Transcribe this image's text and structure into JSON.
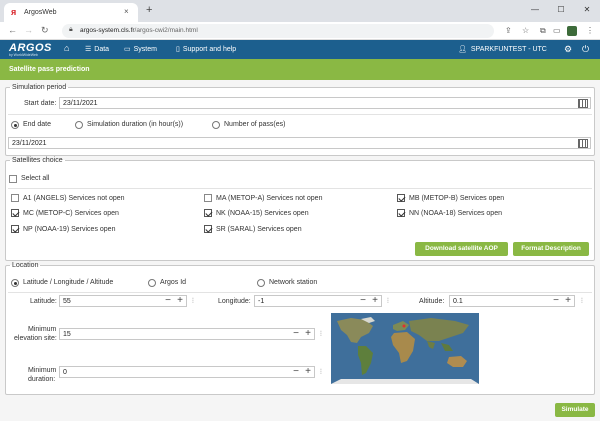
{
  "browser": {
    "tab_title": "ArgosWeb",
    "url_host": "argos-system.cls.fr",
    "url_path": "/argos-cwi2/main.html",
    "tab_close": "×",
    "new_tab": "+",
    "win_min": "—",
    "win_max": "☐",
    "win_close": "✕"
  },
  "nav": {
    "logo": "ARGOS",
    "logo_sub": "by WorldWideWeb",
    "items": [
      {
        "icon": "home-icon",
        "label": ""
      },
      {
        "icon": "database-icon",
        "label": "Data"
      },
      {
        "icon": "monitor-icon",
        "label": "System"
      },
      {
        "icon": "book-icon",
        "label": "Support and help"
      }
    ],
    "user": "SPARKFUNTEST - UTC"
  },
  "page": {
    "title": "Satellite pass prediction"
  },
  "simulation": {
    "legend": "Simulation period",
    "start_label": "Start date:",
    "start_value": "23/11/2021",
    "options": [
      {
        "label": "End date",
        "selected": true
      },
      {
        "label": "Simulation duration (in hour(s))",
        "selected": false
      },
      {
        "label": "Number of pass(es)",
        "selected": false
      }
    ],
    "end_value": "23/11/2021"
  },
  "satellites": {
    "legend": "Satellites choice",
    "select_all": "Select all",
    "items": [
      {
        "label": "A1 (ANGELS) Services not open",
        "checked": false
      },
      {
        "label": "MA (METOP-A) Services not open",
        "checked": false
      },
      {
        "label": "MB (METOP-B) Services open",
        "checked": true
      },
      {
        "label": "MC (METOP-C) Services open",
        "checked": true
      },
      {
        "label": "NK (NOAA-15) Services open",
        "checked": true
      },
      {
        "label": "NN (NOAA-18) Services open",
        "checked": true
      },
      {
        "label": "NP (NOAA-19) Services open",
        "checked": true
      },
      {
        "label": "SR (SARAL) Services open",
        "checked": true
      }
    ],
    "download_btn": "Download satellite AOP",
    "format_btn": "Format Description"
  },
  "location": {
    "legend": "Location",
    "options": [
      {
        "label": "Latitude / Longitude / Altitude",
        "selected": true
      },
      {
        "label": "Argos Id",
        "selected": false
      },
      {
        "label": "Network station",
        "selected": false
      }
    ],
    "latitude_label": "Latitude:",
    "latitude_value": "55",
    "longitude_label": "Longitude:",
    "longitude_value": "-1",
    "altitude_label": "Altitude:",
    "altitude_value": "0.1",
    "elevation_label_1": "Minimum",
    "elevation_label_2": "elevation site:",
    "elevation_value": "15",
    "duration_label_1": "Minimum",
    "duration_label_2": "duration:",
    "duration_value": "0"
  },
  "actions": {
    "simulate": "Simulate"
  },
  "colors": {
    "nav_bg": "#1c5f8e",
    "accent_green": "#8ab844"
  }
}
